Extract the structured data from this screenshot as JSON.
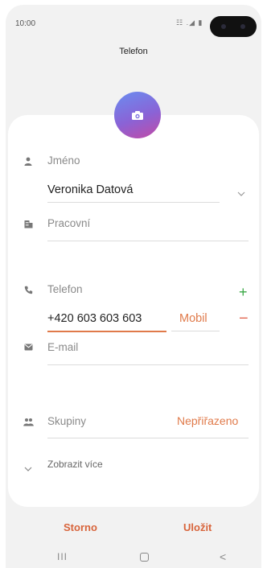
{
  "status_bar": {
    "time": "10:00",
    "icons": "☷ .◢ ▮"
  },
  "header": {
    "title": "Telefon"
  },
  "photo": {
    "icon": "camera-icon"
  },
  "fields": {
    "name_label": "Jméno",
    "name_value": "Veronika Datová",
    "company_placeholder": "Pracovní",
    "phone_label": "Telefon",
    "phone_value": "+420 603 603 603",
    "phone_type": "Mobil",
    "email_placeholder": "E-mail",
    "groups_label": "Skupiny",
    "groups_value": "Nepřiřazeno",
    "more_label": "Zobrazit více"
  },
  "actions": {
    "cancel": "Storno",
    "save": "Uložit"
  },
  "navbar": {
    "recent": "III",
    "back": "<"
  },
  "colors": {
    "accent": "#e07a4a",
    "add": "#3aa845",
    "remove": "#e26a55"
  }
}
